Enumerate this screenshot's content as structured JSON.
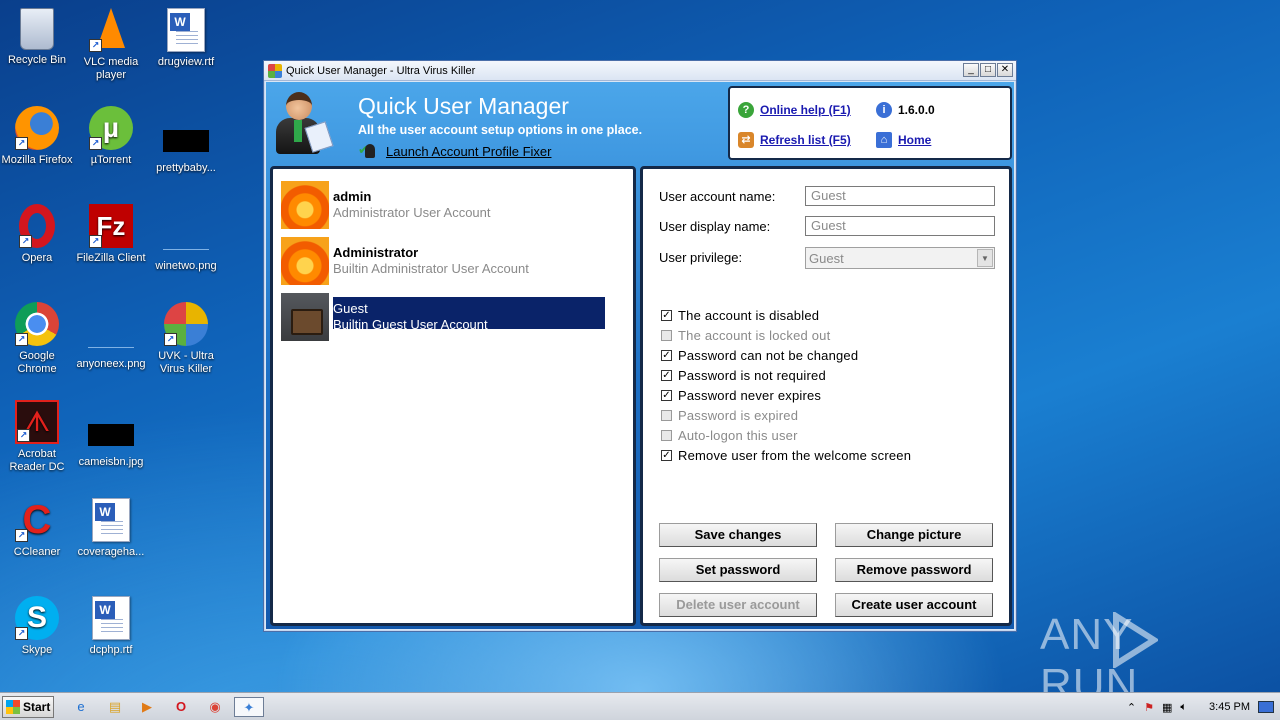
{
  "desktop": {
    "icons": [
      {
        "label": "Recycle Bin"
      },
      {
        "label": "VLC media player"
      },
      {
        "label": "drugview.rtf"
      },
      {
        "label": "Mozilla Firefox"
      },
      {
        "label": "µTorrent"
      },
      {
        "label": "prettybaby..."
      },
      {
        "label": "Opera"
      },
      {
        "label": "FileZilla Client"
      },
      {
        "label": "winetwo.png"
      },
      {
        "label": "Google Chrome"
      },
      {
        "label": "anyoneex.png"
      },
      {
        "label": "UVK - Ultra Virus Killer"
      },
      {
        "label": "Acrobat Reader DC"
      },
      {
        "label": "cameisbn.jpg"
      },
      {
        "label": "CCleaner"
      },
      {
        "label": "coverageha..."
      },
      {
        "label": "Skype"
      },
      {
        "label": "dcphp.rtf"
      }
    ]
  },
  "window": {
    "title": "Quick User Manager - Ultra Virus Killer",
    "controls": {
      "minimize": "_",
      "maximize": "□",
      "close": "✕"
    }
  },
  "header": {
    "title": "Quick User Manager",
    "subtitle": "All the user account setup options in one place.",
    "link": "Launch Account Profile Fixer"
  },
  "info": {
    "help": "Online help (F1)",
    "version": "1.6.0.0",
    "refresh": "Refresh list (F5)",
    "home": "Home"
  },
  "users": [
    {
      "name": "admin",
      "description": "Administrator User Account",
      "picture": "flower",
      "selected": false
    },
    {
      "name": "Administrator",
      "description": "Builtin Administrator User Account",
      "picture": "flower",
      "selected": false
    },
    {
      "name": "Guest",
      "description": "Builtin Guest User Account",
      "picture": "briefcase",
      "selected": true
    }
  ],
  "details": {
    "account_name_label": "User account name:",
    "account_name_value": "Guest",
    "display_name_label": "User display name:",
    "display_name_value": "Guest",
    "privilege_label": "User privilege:",
    "privilege_value": "Guest",
    "options": [
      {
        "label": "The account is disabled",
        "checked": true,
        "enabled": true
      },
      {
        "label": "The account is locked out",
        "checked": false,
        "enabled": false
      },
      {
        "label": "Password can not be changed",
        "checked": true,
        "enabled": true
      },
      {
        "label": "Password is not required",
        "checked": true,
        "enabled": true
      },
      {
        "label": "Password never expires",
        "checked": true,
        "enabled": true
      },
      {
        "label": "Password is expired",
        "checked": false,
        "enabled": false
      },
      {
        "label": "Auto-logon this user",
        "checked": false,
        "enabled": false
      },
      {
        "label": "Remove user from the welcome screen",
        "checked": true,
        "enabled": true
      }
    ]
  },
  "buttons": {
    "save": "Save changes",
    "change_picture": "Change picture",
    "set_password": "Set password",
    "remove_password": "Remove password",
    "delete_account": "Delete user account",
    "create_account": "Create user account"
  },
  "taskbar": {
    "start": "Start",
    "clock": "3:45 PM"
  },
  "watermark": "ANY RUN",
  "colors": {
    "accent": "#1c6fc5",
    "selection": "#0a2369",
    "panel_border": "#142948",
    "link": "#1a1ab0"
  }
}
